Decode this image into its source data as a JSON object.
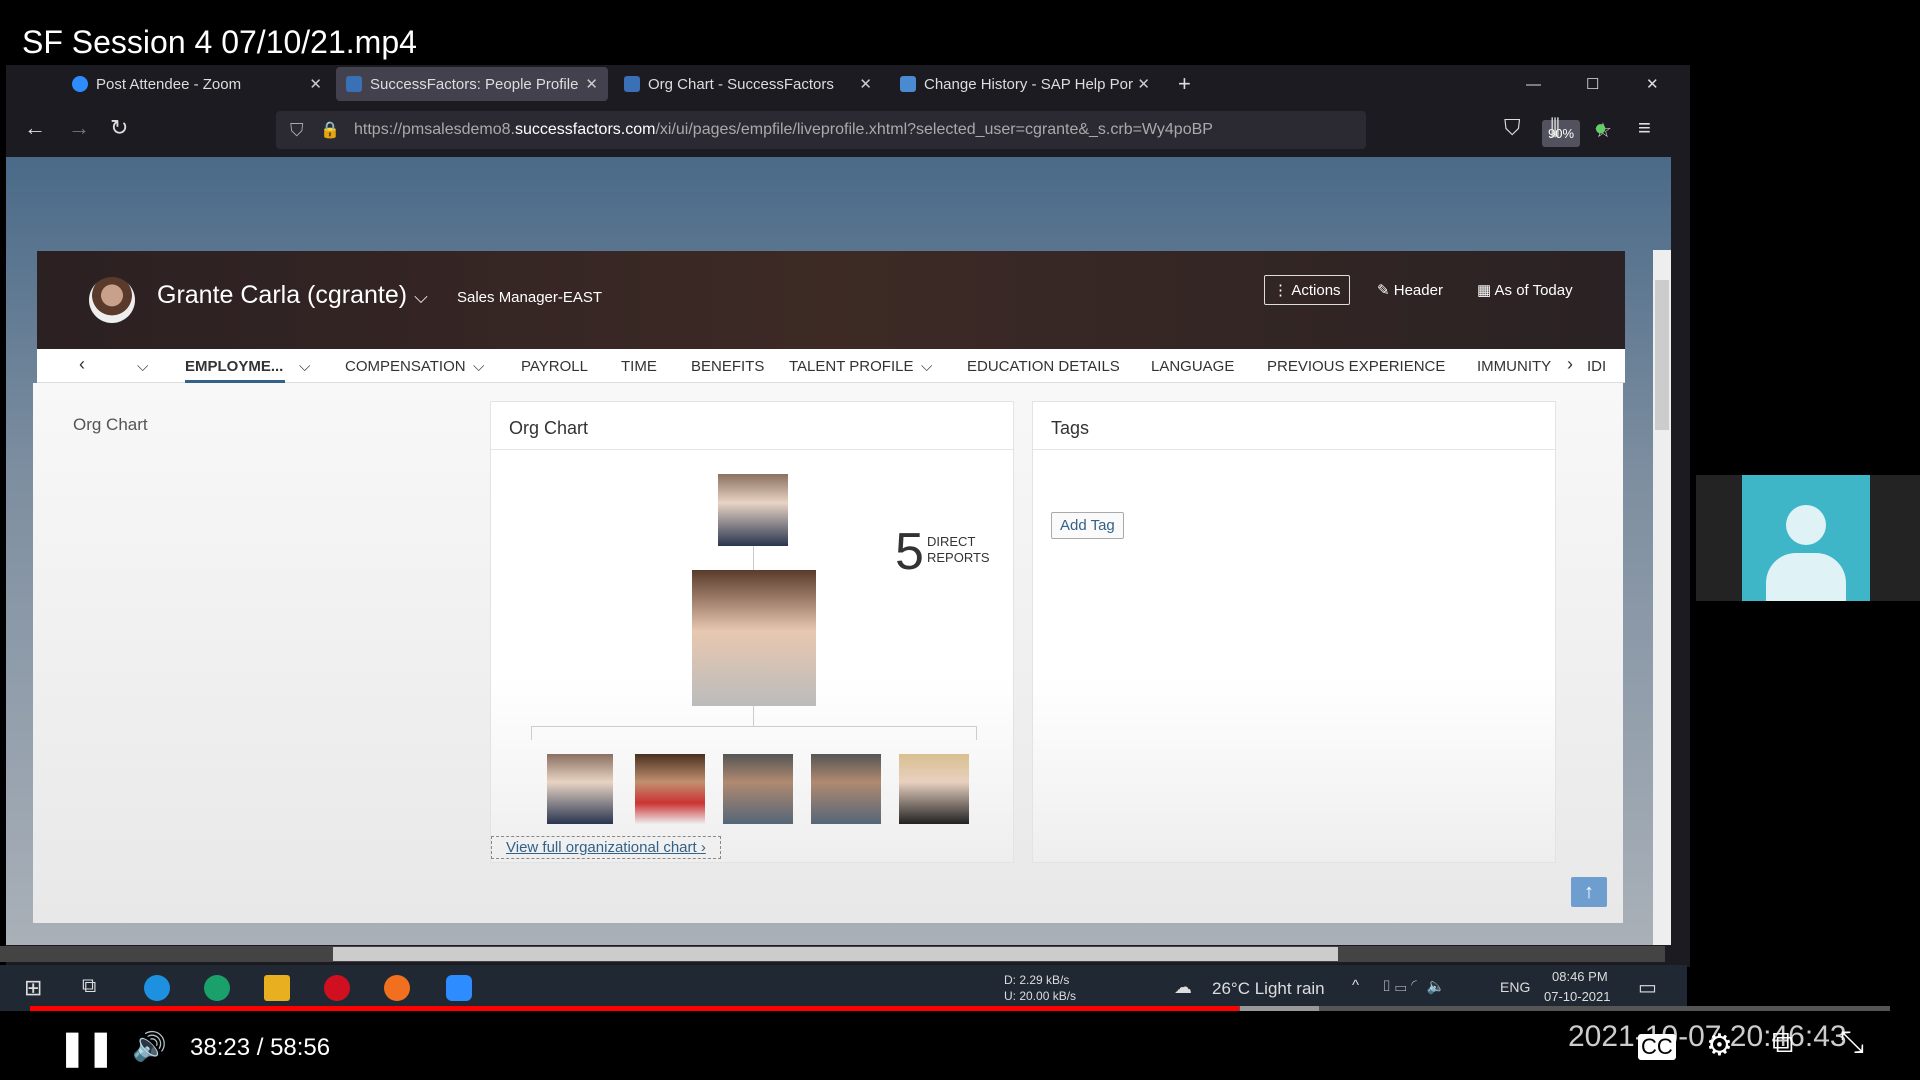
{
  "video": {
    "title": "SF Session 4 07/10/21.mp4",
    "time": "38:23 / 58:56",
    "progress_percent": 65,
    "timestamp": "2021-10-07 20:46:43"
  },
  "browser": {
    "tabs": [
      {
        "label": "Post Attendee - Zoom",
        "active": false
      },
      {
        "label": "SuccessFactors: People Profile",
        "active": true
      },
      {
        "label": "Org Chart - SuccessFactors",
        "active": false
      },
      {
        "label": "Change History - SAP Help Por",
        "active": false
      }
    ],
    "url_prefix": "https://pmsalesdemo8.",
    "url_domain": "successfactors.com",
    "url_rest": "/xi/ui/pages/empfile/liveprofile.xhtml?selected_user=cgrante&_s.crb=Wy4poBP",
    "zoom": "90%"
  },
  "profile": {
    "name": "Grante Carla (cgrante)",
    "role": "Sales Manager-EAST",
    "actions": "Actions",
    "header": "Header",
    "as_of": "As of Today"
  },
  "nav": [
    "EMPLOYME...",
    "COMPENSATION",
    "PAYROLL",
    "TIME",
    "BENEFITS",
    "TALENT PROFILE",
    "EDUCATION DETAILS",
    "LANGUAGE",
    "PREVIOUS EXPERIENCE",
    "IMMUNITY",
    "IDI"
  ],
  "section_label": "Org Chart",
  "org_card": {
    "title": "Org Chart",
    "direct_count": "5",
    "direct_line1": "DIRECT",
    "direct_line2": "REPORTS",
    "view_full": "View full organizational chart"
  },
  "tags_card": {
    "title": "Tags",
    "add_tag": "Add Tag"
  },
  "taskbar": {
    "net_down": "D:   2.29 kB/s",
    "net_up": "U:  20.00 kB/s",
    "weather": "26°C  Light rain",
    "lang": "ENG",
    "clock_time": "08:46 PM",
    "clock_date": "07-10-2021"
  },
  "colors": {
    "accent": "#346187",
    "progress": "#ff0000"
  }
}
